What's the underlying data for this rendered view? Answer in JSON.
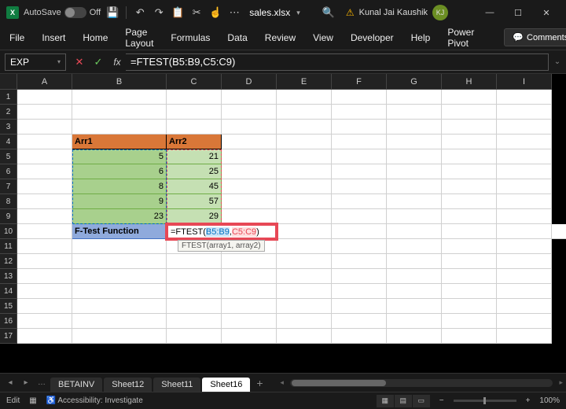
{
  "titlebar": {
    "autosave_label": "AutoSave",
    "autosave_state": "Off",
    "filename": "sales.xlsx",
    "user_name": "Kunal Jai Kaushik",
    "avatar": "KJ"
  },
  "ribbon": {
    "tabs": [
      "File",
      "Insert",
      "Home",
      "Page Layout",
      "Formulas",
      "Data",
      "Review",
      "View",
      "Developer",
      "Help",
      "Power Pivot"
    ],
    "comments": "Comments"
  },
  "formula_bar": {
    "name_box": "EXP",
    "formula": "=FTEST(B5:B9,C5:C9)"
  },
  "columns": [
    "A",
    "B",
    "C",
    "D",
    "E",
    "F",
    "G",
    "H",
    "I"
  ],
  "rows": [
    "1",
    "2",
    "3",
    "4",
    "5",
    "6",
    "7",
    "8",
    "9",
    "10",
    "11",
    "12",
    "13",
    "14",
    "15",
    "16",
    "17"
  ],
  "sheet": {
    "b4": "Arr1",
    "c4": "Arr2",
    "b5": "5",
    "c5": "21",
    "b6": "6",
    "c6": "25",
    "b7": "8",
    "c7": "45",
    "b8": "9",
    "c8": "57",
    "b9": "23",
    "c9": "29",
    "b10": "F-Test Function",
    "c10_prefix": "=FTEST(",
    "c10_arg1": "B5:B9",
    "c10_comma": ",",
    "c10_arg2": "C5:C9",
    "c10_suffix": ")"
  },
  "tooltip": "FTEST(array1, array2)",
  "sheet_tabs": {
    "hidden": "…",
    "tabs": [
      "BETAINV",
      "Sheet12",
      "Sheet11",
      "Sheet16"
    ],
    "active": "Sheet16"
  },
  "status": {
    "mode": "Edit",
    "accessibility": "Accessibility: Investigate",
    "zoom": "100%"
  }
}
